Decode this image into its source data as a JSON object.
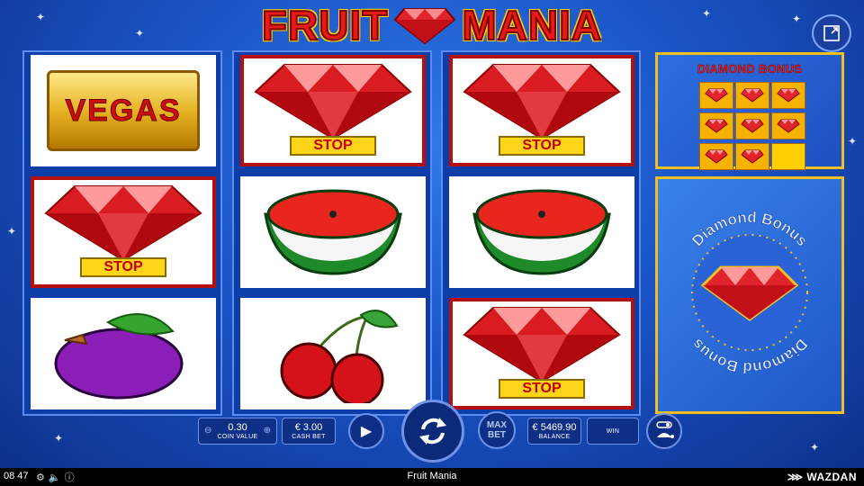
{
  "game_title": {
    "left": "FRUIT",
    "right": "MANIA"
  },
  "reels": [
    [
      {
        "symbol": "vegas",
        "label": "VEGAS"
      },
      {
        "symbol": "diamond-stop",
        "label": "STOP"
      },
      {
        "symbol": "plum"
      }
    ],
    [
      {
        "symbol": "diamond-stop",
        "label": "STOP"
      },
      {
        "symbol": "watermelon"
      },
      {
        "symbol": "cherries"
      }
    ],
    [
      {
        "symbol": "diamond-stop",
        "label": "STOP"
      },
      {
        "symbol": "watermelon"
      },
      {
        "symbol": "diamond-stop",
        "label": "STOP"
      }
    ]
  ],
  "diamond_bonus_panel": {
    "title": "DIAMOND BONUS",
    "grid": [
      true,
      true,
      true,
      true,
      true,
      true,
      true,
      true,
      false
    ]
  },
  "bonus_badge": {
    "top_text": "Diamond Bonus",
    "bottom_text": "Diamond Bonus"
  },
  "controls": {
    "coin_value": {
      "value": "0.30",
      "label": "COIN VALUE"
    },
    "cash_bet": {
      "value": "€ 3.00",
      "label": "CASH BET"
    },
    "max_bet": {
      "line1": "MAX",
      "line2": "BET"
    },
    "balance": {
      "value": "€ 5469.90",
      "label": "BALANCE"
    },
    "win": {
      "value": "",
      "label": "WIN"
    }
  },
  "bottom_bar": {
    "time": "08 47",
    "title": "Fruit Mania",
    "brand": "WAZDAN"
  },
  "colors": {
    "background": "#1a54c6",
    "title_red": "#e81a14",
    "gold": "#f0c020",
    "stop_yellow": "#ffd51a"
  }
}
